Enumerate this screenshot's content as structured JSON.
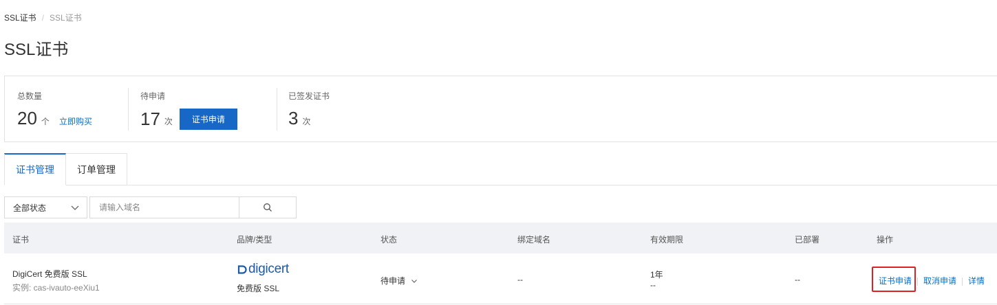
{
  "breadcrumb": {
    "root": "SSL证书",
    "separator": "/",
    "current": "SSL证书"
  },
  "page_title": "SSL证书",
  "stats": {
    "total": {
      "label": "总数量",
      "value": "20",
      "unit": "个",
      "link": "立即购买"
    },
    "pending": {
      "label": "待申请",
      "value": "17",
      "unit": "次",
      "button": "证书申请"
    },
    "issued": {
      "label": "已签发证书",
      "value": "3",
      "unit": "次"
    }
  },
  "tabs": [
    {
      "label": "证书管理",
      "active": true
    },
    {
      "label": "订单管理",
      "active": false
    }
  ],
  "filter": {
    "status_selected": "全部状态",
    "search_placeholder": "请输入域名"
  },
  "table": {
    "columns": [
      "证书",
      "品牌/类型",
      "状态",
      "绑定域名",
      "有效期限",
      "已部署",
      "操作"
    ],
    "rows": [
      {
        "cert_name": "DigiCert 免费版 SSL",
        "instance": "实例: cas-ivauto-eeXiu1",
        "brand_logo": "digicert",
        "brand_type": "免费版 SSL",
        "status": "待申请",
        "domain": "--",
        "validity": "1年",
        "validity_sub": "--",
        "deployed": "--",
        "actions": [
          "证书申请",
          "取消申请",
          "详情"
        ]
      }
    ]
  },
  "colors": {
    "accent": "#1767c7",
    "link": "#0070cc",
    "highlight": "#e02020"
  }
}
